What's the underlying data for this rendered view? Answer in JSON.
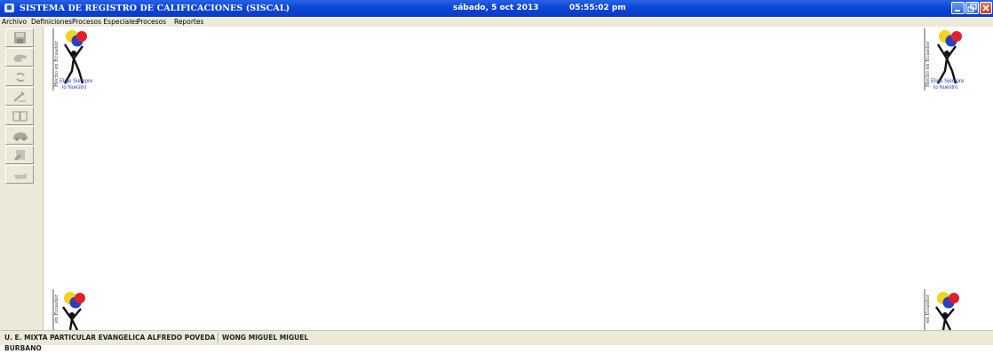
{
  "window": {
    "title": "SISTEMA DE REGISTRO DE CALIFICACIONES   (SISCAL)",
    "date": "sábado, 5 oct 2013",
    "time": "05:55:02 pm"
  },
  "menu": {
    "items": [
      "Archivo",
      "Definiciones",
      "Procesos Especiales",
      "Procesos",
      "Reportes"
    ]
  },
  "toolbar": {
    "icons": [
      "save-icon",
      "hand-icon",
      "refresh-icon",
      "wrench-icon",
      "book-icon",
      "car-icon",
      "document-edit-icon",
      "hand-point-icon"
    ]
  },
  "logo": {
    "slogan_line1": "Elige Siempre",
    "slogan_line2": "lo Nuestro",
    "side_text": "Hecho en Ecuador",
    "side_text_short": "en Ecuador"
  },
  "status": {
    "institution": "U. E. MIXTA PARTICULAR EVANGELICA ALFREDO POVEDA BURBANO",
    "user": "WONG MIGUEL MIGUEL"
  },
  "colors": {
    "titlebar": "#0b45d6",
    "chrome": "#ece9d8",
    "logo_yellow": "#f2d21a",
    "logo_blue": "#2a3fc0",
    "logo_red": "#e0202a"
  }
}
